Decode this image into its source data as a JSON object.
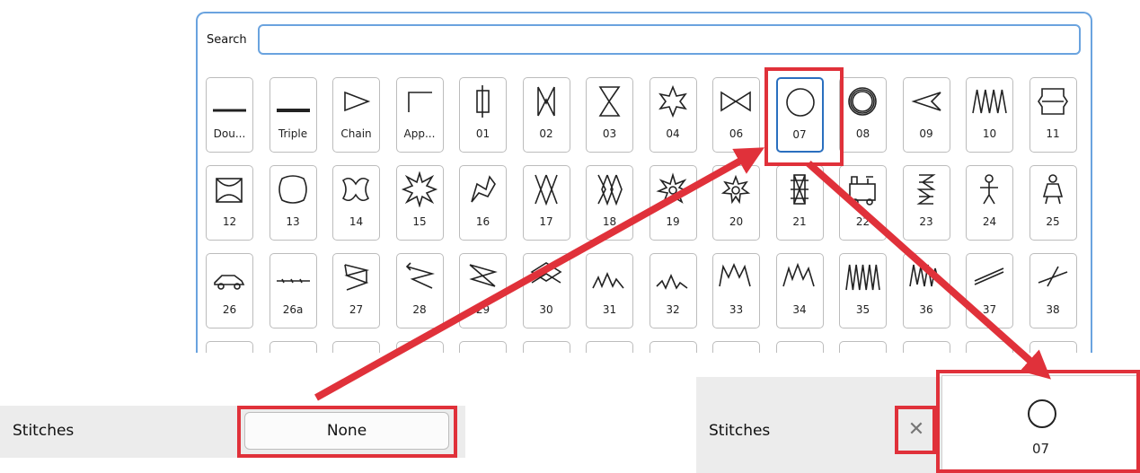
{
  "search": {
    "label": "Search",
    "value": "",
    "placeholder": ""
  },
  "stitch_tiles": [
    {
      "label": "Dou...",
      "icon": "double-line-icon"
    },
    {
      "label": "Triple",
      "icon": "triple-line-icon"
    },
    {
      "label": "Chain",
      "icon": "chain-icon"
    },
    {
      "label": "App...",
      "icon": "applique-icon"
    },
    {
      "label": "01",
      "icon": "stitch-01-icon"
    },
    {
      "label": "02",
      "icon": "stitch-02-icon"
    },
    {
      "label": "03",
      "icon": "stitch-03-icon"
    },
    {
      "label": "04",
      "icon": "stitch-04-icon"
    },
    {
      "label": "06",
      "icon": "stitch-06-icon"
    },
    {
      "label": "07",
      "icon": "circle-icon"
    },
    {
      "label": "08",
      "icon": "double-circle-icon"
    },
    {
      "label": "09",
      "icon": "stitch-09-icon"
    },
    {
      "label": "10",
      "icon": "stitch-10-icon"
    },
    {
      "label": "11",
      "icon": "stitch-11-icon"
    },
    {
      "label": "12",
      "icon": "stitch-12-icon"
    },
    {
      "label": "13",
      "icon": "stitch-13-icon"
    },
    {
      "label": "14",
      "icon": "stitch-14-icon"
    },
    {
      "label": "15",
      "icon": "stitch-15-icon"
    },
    {
      "label": "16",
      "icon": "stitch-16-icon"
    },
    {
      "label": "17",
      "icon": "stitch-17-icon"
    },
    {
      "label": "18",
      "icon": "stitch-18-icon"
    },
    {
      "label": "19",
      "icon": "stitch-19-icon"
    },
    {
      "label": "20",
      "icon": "stitch-20-icon"
    },
    {
      "label": "21",
      "icon": "stitch-21-icon"
    },
    {
      "label": "22",
      "icon": "stitch-22-icon"
    },
    {
      "label": "23",
      "icon": "stitch-23-icon"
    },
    {
      "label": "24",
      "icon": "stitch-24-icon"
    },
    {
      "label": "25",
      "icon": "stitch-25-icon"
    },
    {
      "label": "26",
      "icon": "stitch-26-icon"
    },
    {
      "label": "26a",
      "icon": "stitch-26a-icon"
    },
    {
      "label": "27",
      "icon": "stitch-27-icon"
    },
    {
      "label": "28",
      "icon": "stitch-28-icon"
    },
    {
      "label": "29",
      "icon": "stitch-29-icon"
    },
    {
      "label": "30",
      "icon": "stitch-30-icon"
    },
    {
      "label": "31",
      "icon": "stitch-31-icon"
    },
    {
      "label": "32",
      "icon": "stitch-32-icon"
    },
    {
      "label": "33",
      "icon": "stitch-33-icon"
    },
    {
      "label": "34",
      "icon": "stitch-34-icon"
    },
    {
      "label": "35",
      "icon": "stitch-35-icon"
    },
    {
      "label": "36",
      "icon": "stitch-36-icon"
    },
    {
      "label": "37",
      "icon": "stitch-37-icon"
    },
    {
      "label": "38",
      "icon": "stitch-38-icon"
    }
  ],
  "selected_label": "07",
  "before": {
    "stitches_label": "Stitches",
    "value": "None"
  },
  "after": {
    "stitches_label": "Stitches",
    "value": "07",
    "clear_icon": "close-icon"
  },
  "colors": {
    "highlight": "#e0313a",
    "accent": "#6aa3df",
    "selected_border": "#2a6fbf"
  }
}
